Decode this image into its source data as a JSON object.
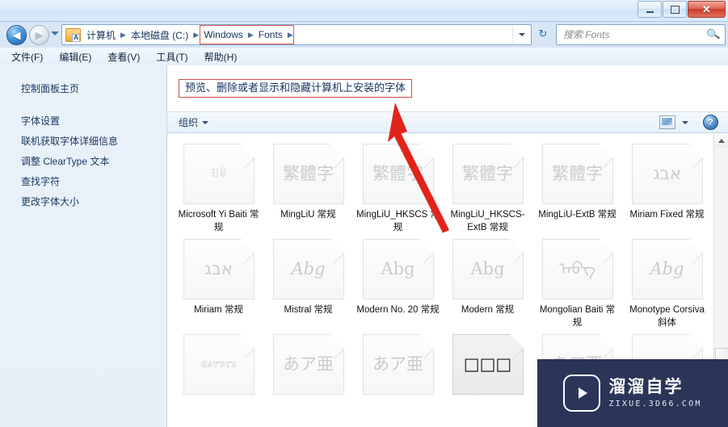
{
  "window": {
    "minimize_label": "—",
    "maximize_label": "□",
    "close_label": "✕"
  },
  "address_bar": {
    "back_label": "◀",
    "forward_label": "▶",
    "folder_icon": "folder-icon",
    "crumbs": [
      {
        "label": "计算机",
        "highlighted": false
      },
      {
        "label": "本地磁盘 (C:)",
        "highlighted": false
      },
      {
        "label": "Windows",
        "highlighted": true
      },
      {
        "label": "Fonts",
        "highlighted": true
      }
    ],
    "separator": "▶",
    "dropdown_icon": "chevron-down-icon",
    "refresh_label": "↻"
  },
  "search": {
    "placeholder": "搜索 Fonts",
    "value": "",
    "icon_label": "🔍"
  },
  "menubar": {
    "items": [
      {
        "label": "文件(F)"
      },
      {
        "label": "编辑(E)"
      },
      {
        "label": "查看(V)"
      },
      {
        "label": "工具(T)"
      },
      {
        "label": "帮助(H)"
      }
    ]
  },
  "sidebar": {
    "home_label": "控制面板主页",
    "links": [
      {
        "label": "字体设置"
      },
      {
        "label": "联机获取字体详细信息"
      },
      {
        "label": "调整 ClearType 文本"
      },
      {
        "label": "查找字符"
      },
      {
        "label": "更改字体大小"
      }
    ]
  },
  "content": {
    "header_title": "预览、删除或者显示和隐藏计算机上安装的字体",
    "header_box_color": "#cf4b42"
  },
  "toolbar": {
    "organize_label": "组织",
    "organize_caret": "chevron-down-icon",
    "view_icon": "view-options-icon",
    "view_caret": "chevron-down-icon",
    "help_label": "?"
  },
  "fonts": {
    "rows": [
      [
        {
          "name": "Microsoft Yi Baiti 常规",
          "preview": "ꀀꀁ",
          "style": "small",
          "selected": false
        },
        {
          "name": "MingLiU 常规",
          "preview": "繁體字",
          "style": "",
          "selected": false
        },
        {
          "name": "MingLiU_HKSCS 常规",
          "preview": "繁體字",
          "style": "",
          "selected": false
        },
        {
          "name": "MingLiU_HKSCS-ExtB 常规",
          "preview": "繁體字",
          "style": "",
          "selected": false
        },
        {
          "name": "MingLiU-ExtB 常规",
          "preview": "繁體字",
          "style": "",
          "selected": false
        },
        {
          "name": "Miriam Fixed 常规",
          "preview": "אבג",
          "style": "",
          "selected": false
        }
      ],
      [
        {
          "name": "Miriam 常规",
          "preview": "אבג",
          "style": "",
          "selected": false
        },
        {
          "name": "Mistral 常规",
          "preview": "Abg",
          "style": "script",
          "selected": false
        },
        {
          "name": "Modern No. 20 常规",
          "preview": "Abg",
          "style": "serif",
          "selected": false
        },
        {
          "name": "Modern 常规",
          "preview": "Abg",
          "style": "serif",
          "selected": false
        },
        {
          "name": "Mongolian Baiti 常规",
          "preview": "ᠠᠪᠭ",
          "style": "",
          "selected": false
        },
        {
          "name": "Monotype Corsiva 斜体",
          "preview": "Abg",
          "style": "script",
          "selected": false
        }
      ],
      [
        {
          "name": "",
          "preview": "ᬅᬩᬕ",
          "style": "small",
          "selected": false
        },
        {
          "name": "",
          "preview": "あア亜",
          "style": "",
          "selected": false
        },
        {
          "name": "",
          "preview": "あア亜",
          "style": "",
          "selected": false
        },
        {
          "name": "",
          "preview": "□□□",
          "style": "dark",
          "selected": true
        },
        {
          "name": "",
          "preview": "あア亜",
          "style": "",
          "selected": false
        },
        {
          "name": "",
          "preview": "",
          "style": "",
          "selected": false
        }
      ]
    ]
  },
  "scrollbar": {
    "up_label": "▲",
    "down_label": "▼"
  },
  "watermark": {
    "title": "溜溜自学",
    "subtitle": "ZIXUE.3D66.COM",
    "logo_icon": "play-logo-icon",
    "bg_color": "#2b3558"
  }
}
